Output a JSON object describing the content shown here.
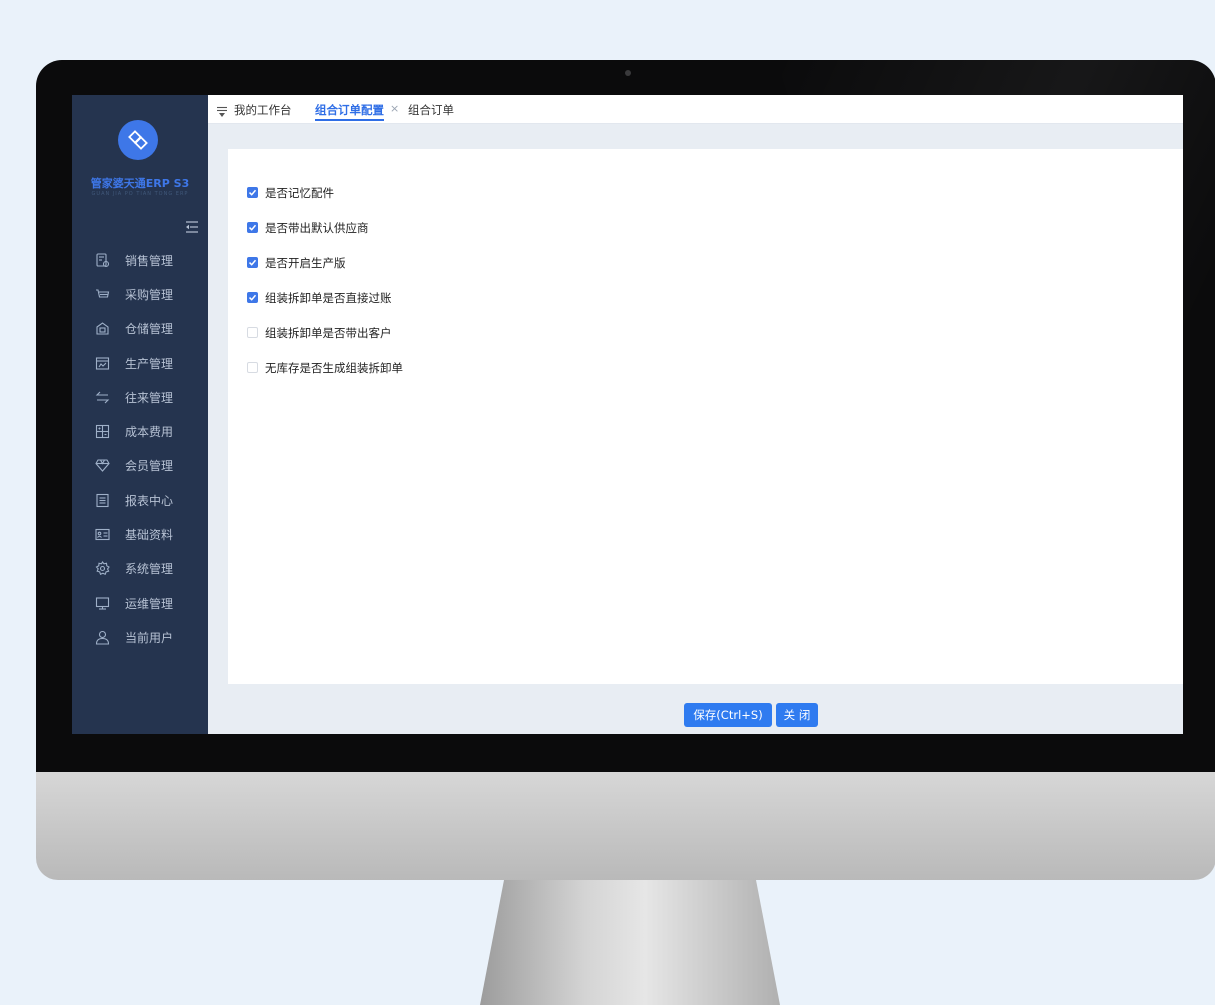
{
  "brand": {
    "name": "管家婆天通ERP S3",
    "subtitle": "GUAN JIA PO TIAN TONG ERP",
    "accent_color": "#3e77e8"
  },
  "sidebar": {
    "items": [
      {
        "label": "销售管理",
        "icon": "sales-doc-icon"
      },
      {
        "label": "采购管理",
        "icon": "cart-icon"
      },
      {
        "label": "仓储管理",
        "icon": "warehouse-icon"
      },
      {
        "label": "生产管理",
        "icon": "factory-icon"
      },
      {
        "label": "往来管理",
        "icon": "exchange-arrows-icon"
      },
      {
        "label": "成本费用",
        "icon": "calculator-icon"
      },
      {
        "label": "会员管理",
        "icon": "diamond-icon"
      },
      {
        "label": "报表中心",
        "icon": "report-icon"
      },
      {
        "label": "基础资料",
        "icon": "id-card-icon"
      },
      {
        "label": "系统管理",
        "icon": "gear-icon"
      },
      {
        "label": "运维管理",
        "icon": "monitor-icon"
      },
      {
        "label": "当前用户",
        "icon": "user-icon"
      }
    ]
  },
  "tabs": [
    {
      "label": "我的工作台",
      "active": false
    },
    {
      "label": "组合订单配置",
      "active": true,
      "close": "×"
    },
    {
      "label": "组合订单",
      "active": false
    }
  ],
  "options": [
    {
      "label": "是否记忆配件",
      "checked": true
    },
    {
      "label": "是否带出默认供应商",
      "checked": true
    },
    {
      "label": "是否开启生产版",
      "checked": true
    },
    {
      "label": "组装拆卸单是否直接过账",
      "checked": true
    },
    {
      "label": "组装拆卸单是否带出客户",
      "checked": false
    },
    {
      "label": "无库存是否生成组装拆卸单",
      "checked": false
    }
  ],
  "buttons": {
    "save": "保存(Ctrl+S)",
    "close": "关 闭"
  }
}
